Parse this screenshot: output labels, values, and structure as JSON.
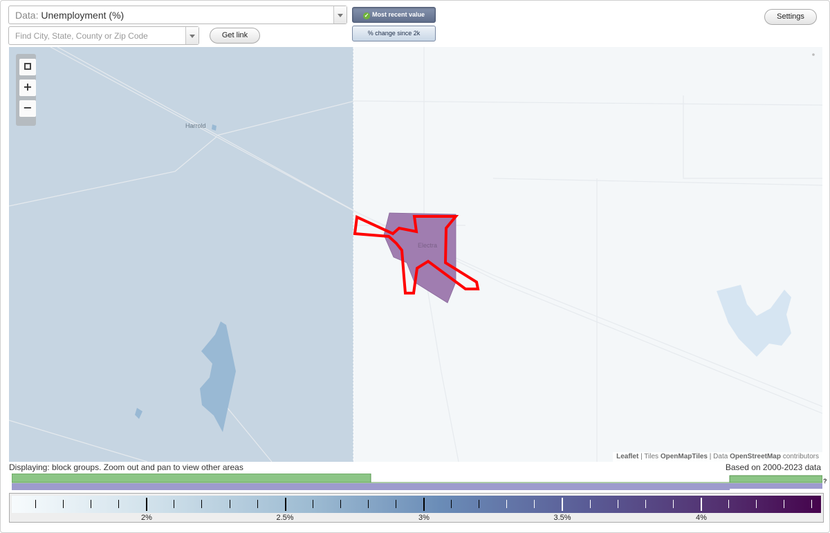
{
  "controls": {
    "data_prefix": "Data:",
    "data_value": "Unemployment (%)",
    "search_placeholder": "Find City, State, County or Zip Code",
    "get_link_label": "Get link",
    "most_recent_label": "Most recent value",
    "pct_change_label": "% change since 2k",
    "settings_label": "Settings"
  },
  "map": {
    "places": [
      "Harrold",
      "Electra"
    ],
    "attribution": {
      "leaflet": "Leaflet",
      "sep1": " | Tiles ",
      "tiles": "OpenMapTiles",
      "sep2": " | Data ",
      "data": "OpenStreetMap",
      "suffix": " contributors"
    }
  },
  "footer": {
    "displaying": "Displaying: block groups. Zoom out and pan to view other areas",
    "based_on": "Based on 2000-2023 data",
    "qmark": "?"
  },
  "legend": {
    "labels": [
      "2%",
      "2.5%",
      "3%",
      "3.5%",
      "4%"
    ],
    "colors": {
      "low": "#f7fbfd",
      "high": "#45034c",
      "highlight": "#ff0000"
    }
  }
}
